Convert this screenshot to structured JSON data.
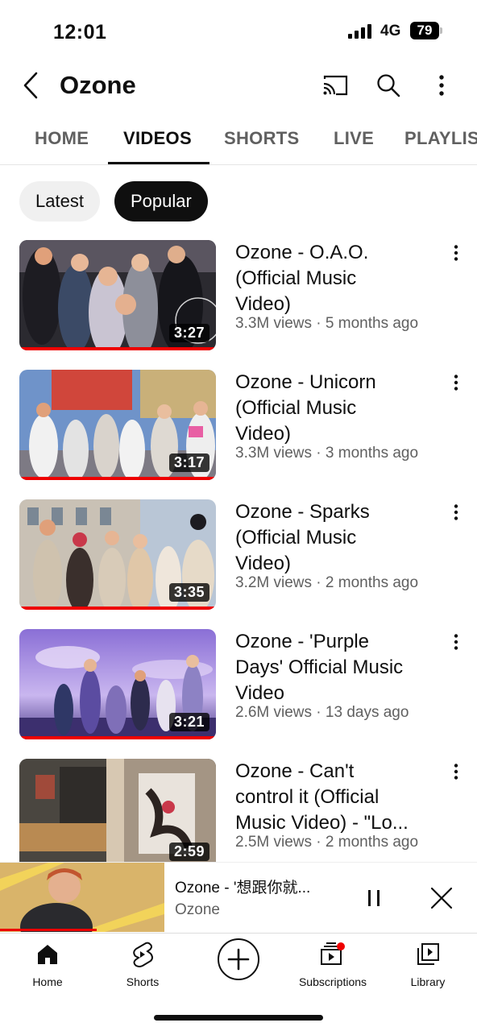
{
  "status_bar": {
    "time": "12:01",
    "network": "4G",
    "battery": "79"
  },
  "header": {
    "title": "Ozone"
  },
  "tabs": [
    {
      "label": "HOME"
    },
    {
      "label": "VIDEOS"
    },
    {
      "label": "SHORTS"
    },
    {
      "label": "LIVE"
    },
    {
      "label": "PLAYLIS"
    }
  ],
  "active_tab": "VIDEOS",
  "chips": [
    {
      "label": "Latest"
    },
    {
      "label": "Popular"
    }
  ],
  "active_chip": "Popular",
  "videos": [
    {
      "title_line1": "Ozone - O.A.O.",
      "title_line2": "(Official Music",
      "title_line3": "Video)",
      "meta": "3.3M views · 5 months ago",
      "duration": "3:27"
    },
    {
      "title_line1": "Ozone - Unicorn",
      "title_line2": "(Official Music",
      "title_line3": "Video)",
      "meta": "3.3M views · 3 months ago",
      "duration": "3:17"
    },
    {
      "title_line1": "Ozone - Sparks",
      "title_line2": "(Official Music",
      "title_line3": "Video)",
      "meta": "3.2M views · 2 months ago",
      "duration": "3:35"
    },
    {
      "title_line1": "Ozone - 'Purple",
      "title_line2": "Days' Official Music",
      "title_line3": "Video",
      "meta": "2.6M views · 13 days ago",
      "duration": "3:21"
    },
    {
      "title_line1": "Ozone - Can't",
      "title_line2": "control it (Official",
      "title_line3": "Music Video) - \"Lo...",
      "meta": "2.5M views · 2 months ago",
      "duration": "2:59"
    }
  ],
  "mini_player": {
    "title": "Ozone - '想跟你就...",
    "channel": "Ozone"
  },
  "bottom_nav": [
    {
      "label": "Home",
      "icon": "home-icon"
    },
    {
      "label": "Shorts",
      "icon": "shorts-icon"
    },
    {
      "label": "",
      "icon": "create-icon"
    },
    {
      "label": "Subscriptions",
      "icon": "subscriptions-icon"
    },
    {
      "label": "Library",
      "icon": "library-icon"
    }
  ],
  "colors": {
    "accent_red": "#ee0000",
    "text_primary": "#0f0f0f",
    "text_secondary": "#606060"
  }
}
